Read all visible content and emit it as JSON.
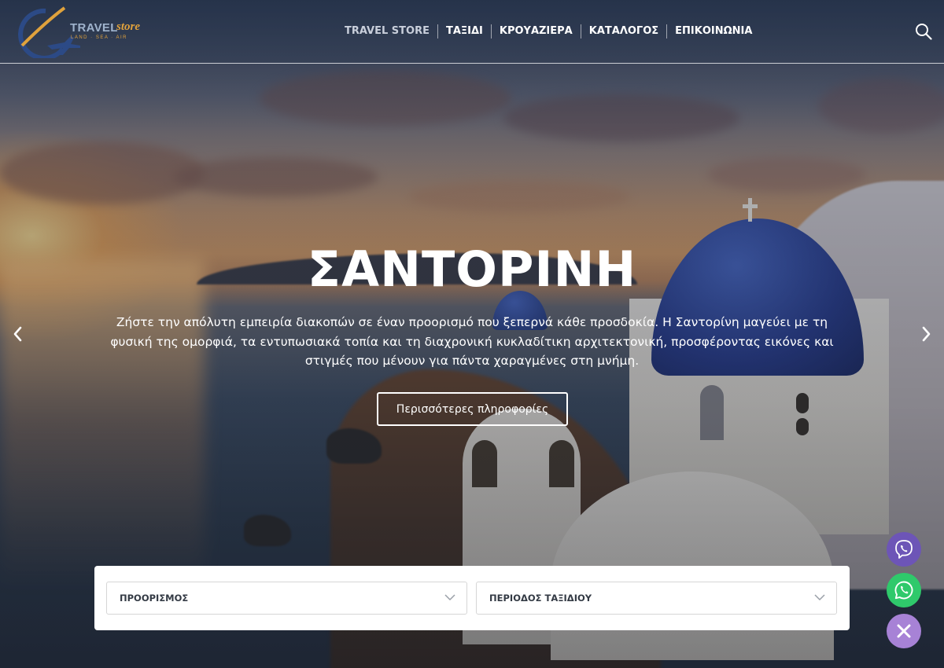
{
  "brand": {
    "name_part1": "TRAVEL",
    "name_part2": "store",
    "tagline": "LAND · SEA · AIR",
    "logo_icon": "airplane-globe-logo",
    "colors": {
      "blue": "#2c4a86",
      "orange": "#e0a23c"
    }
  },
  "nav": {
    "items": [
      {
        "label": "TRAVEL STORE",
        "active": true
      },
      {
        "label": "ΤΑΞΙΔΙ",
        "active": false
      },
      {
        "label": "ΚΡΟΥΑΖΙΕΡΑ",
        "active": false
      },
      {
        "label": "ΚΑΤΑΛΟΓΟΣ",
        "active": false
      },
      {
        "label": "ΕΠΙΚΟΙΝΩΝΙΑ",
        "active": false
      }
    ],
    "search_icon": "search-icon"
  },
  "hero": {
    "title": "ΣΑΝΤΟΡΙΝΗ",
    "description": "Ζήστε την απόλυτη εμπειρία διακοπών σε έναν προορισμό που ξεπερνά κάθε προσδοκία. Η Σαντορίνη μαγεύει με τη φυσική της ομορφιά, τα εντυπωσιακά τοπία και τη διαχρονική κυκλαδίτικη αρχιτεκτονική, προσφέροντας εικόνες και στιγμές που μένουν για πάντα χαραγμένες στη μνήμη.",
    "button_label": "Περισσότερες πληροφορίες",
    "prev_icon": "chevron-left-icon",
    "next_icon": "chevron-right-icon"
  },
  "search": {
    "destination_label": "ΠΡΟΟΡΙΣΜΟΣ",
    "period_label": "ΠΕΡΙΟΔΟΣ ΤΑΞΙΔΙΟΥ",
    "chevron_icon": "chevron-down-icon"
  },
  "contact": {
    "viber": {
      "icon": "viber-icon",
      "color": "#6d55b7"
    },
    "whatsapp": {
      "icon": "whatsapp-icon",
      "color": "#2fc96b"
    },
    "close": {
      "icon": "close-icon",
      "color": "#a782d6"
    }
  }
}
